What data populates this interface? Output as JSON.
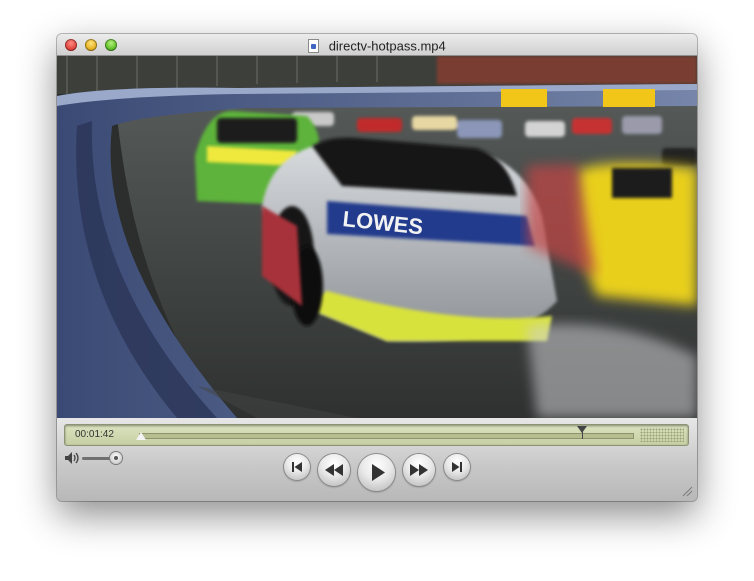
{
  "window": {
    "title": "directv-hotpass.mp4",
    "traffic_lights": [
      "close-button",
      "minimize-button",
      "zoom-button"
    ],
    "title_icon": "movie-document-icon"
  },
  "video": {
    "sponsor_text": "LOWES"
  },
  "controls": {
    "current_time": "00:01:42",
    "progress": 0.0,
    "selection_end_marker": 0.895,
    "volume": 0.85,
    "buttons": [
      {
        "name": "previous-chapter-button",
        "icon": "skip-back-icon"
      },
      {
        "name": "rewind-button",
        "icon": "rewind-icon"
      },
      {
        "name": "play-button",
        "icon": "play-icon"
      },
      {
        "name": "fast-forward-button",
        "icon": "fast-forward-icon"
      },
      {
        "name": "next-chapter-button",
        "icon": "skip-forward-icon"
      }
    ]
  }
}
